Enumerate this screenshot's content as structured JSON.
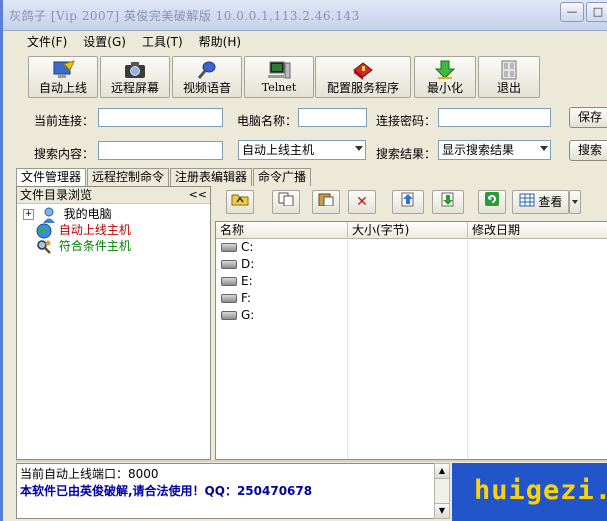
{
  "title": "灰鸽子 [Vip 2007] 英俊完美破解版 10.0.0.1,113.2.46.143",
  "titlebar_buttons": [
    "—",
    "□"
  ],
  "menu": [
    "文件(F)",
    "设置(G)",
    "工具(T)",
    "帮助(H)"
  ],
  "toolbar": [
    {
      "label": "自动上线",
      "icon": "auto-online-icon"
    },
    {
      "label": "远程屏幕",
      "icon": "camera-icon"
    },
    {
      "label": "视频语音",
      "icon": "microphone-icon"
    },
    {
      "label": "Telnet",
      "icon": "telnet-computer-icon"
    },
    {
      "label": "配置服务程序",
      "icon": "config-server-icon"
    },
    {
      "label": "最小化",
      "icon": "minimize-arrow-icon"
    },
    {
      "label": "退出",
      "icon": "exit-door-icon"
    }
  ],
  "connection": {
    "current_label": "当前连接：",
    "current_value": "",
    "computer_label": "电脑名称：",
    "computer_value": "",
    "password_label": "连接密码：",
    "password_value": "",
    "save_label": "保存"
  },
  "search": {
    "content_label": "搜索内容：",
    "content_value": "",
    "scope_value": "自动上线主机",
    "result_label": "搜索结果：",
    "result_value": "显示搜索结果",
    "search_label": "搜索"
  },
  "tabs": [
    {
      "label": "文件管理器",
      "active": true
    },
    {
      "label": "远程控制命令",
      "active": false
    },
    {
      "label": "注册表编辑器",
      "active": false
    },
    {
      "label": "命令广播",
      "active": false
    }
  ],
  "tree": {
    "header": "文件目录浏览",
    "collapse_glyph": "<<",
    "expander": "+",
    "items": [
      {
        "label": "我的电脑",
        "color": "#000000"
      },
      {
        "label": "自动上线主机",
        "color": "#c00000"
      },
      {
        "label": "符合条件主机",
        "color": "#008000"
      }
    ]
  },
  "file_toolbar": {
    "view_label": "查看"
  },
  "file_list": {
    "columns": [
      "名称",
      "大小(字节)",
      "修改日期"
    ],
    "rows": [
      {
        "name": "C:"
      },
      {
        "name": "D:"
      },
      {
        "name": "E:"
      },
      {
        "name": "F:"
      },
      {
        "name": "G:"
      }
    ]
  },
  "status": {
    "line1": "当前自动上线端口：8000",
    "line2": "本软件已由英俊破解,请合法使用！QQ：250470678"
  },
  "banner": {
    "text": "huigezi.n",
    "background": "#2255c9",
    "text_color": "#f8d20b"
  }
}
